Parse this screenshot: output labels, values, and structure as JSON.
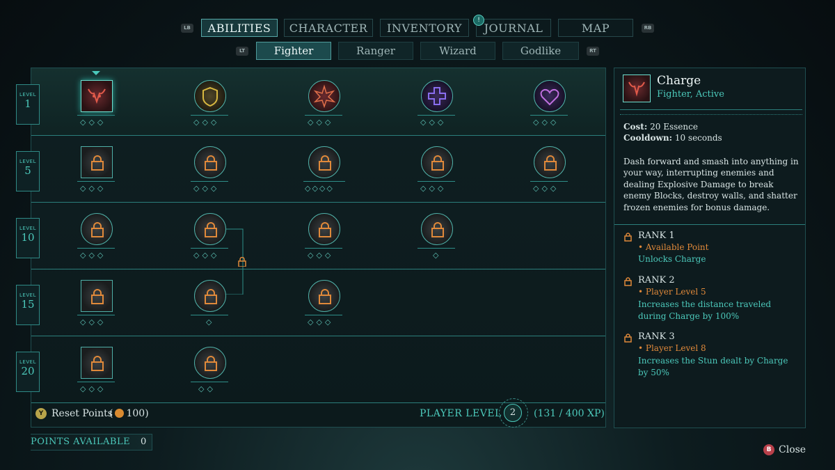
{
  "nav": {
    "lb": "LB",
    "rb": "RB",
    "lt": "LT",
    "rt": "RT",
    "tabs": [
      {
        "label": "ABILITIES",
        "active": true
      },
      {
        "label": "CHARACTER",
        "active": false
      },
      {
        "label": "INVENTORY",
        "active": false
      },
      {
        "label": "JOURNAL",
        "active": false
      },
      {
        "label": "MAP",
        "active": false
      }
    ],
    "journal_alert": "!",
    "subtabs": [
      {
        "label": "Fighter",
        "active": true
      },
      {
        "label": "Ranger",
        "active": false
      },
      {
        "label": "Wizard",
        "active": false
      },
      {
        "label": "Godlike",
        "active": false
      }
    ]
  },
  "tree": {
    "level_word": "LEVEL",
    "levels": [
      "1",
      "5",
      "10",
      "15",
      "20"
    ]
  },
  "footer": {
    "reset_button": "Y",
    "reset_label": "Reset Points",
    "reset_cost": "100",
    "player_level_label": "PLAYER LEVEL",
    "player_level": "2",
    "xp": "(131 / 400 XP)",
    "points_available_label": "POINTS AVAILABLE",
    "points_available": "0",
    "close_button": "B",
    "close_label": "Close"
  },
  "detail": {
    "title": "Charge",
    "subtitle": "Fighter, Active",
    "cost_label": "Cost:",
    "cost_value": "20 Essence",
    "cooldown_label": "Cooldown:",
    "cooldown_value": "10 seconds",
    "description": "Dash forward and smash into anything in your way, interrupting enemies and dealing Explosive Damage to break enemy Blocks, destroy walls, and shatter frozen enemies for bonus damage.",
    "ranks": [
      {
        "title": "RANK 1",
        "req": "• Available Point",
        "text": "Unlocks Charge"
      },
      {
        "title": "RANK 2",
        "req": "• Player Level 5",
        "text": "Increases the distance traveled during Charge by 100%"
      },
      {
        "title": "RANK 3",
        "req": "• Player Level 8",
        "text": "Increases the Stun dealt by Charge by 50%"
      }
    ]
  },
  "colors": {
    "accent": "#4cc9bb",
    "requirement": "#e0893a",
    "lock": "#e0893a"
  }
}
